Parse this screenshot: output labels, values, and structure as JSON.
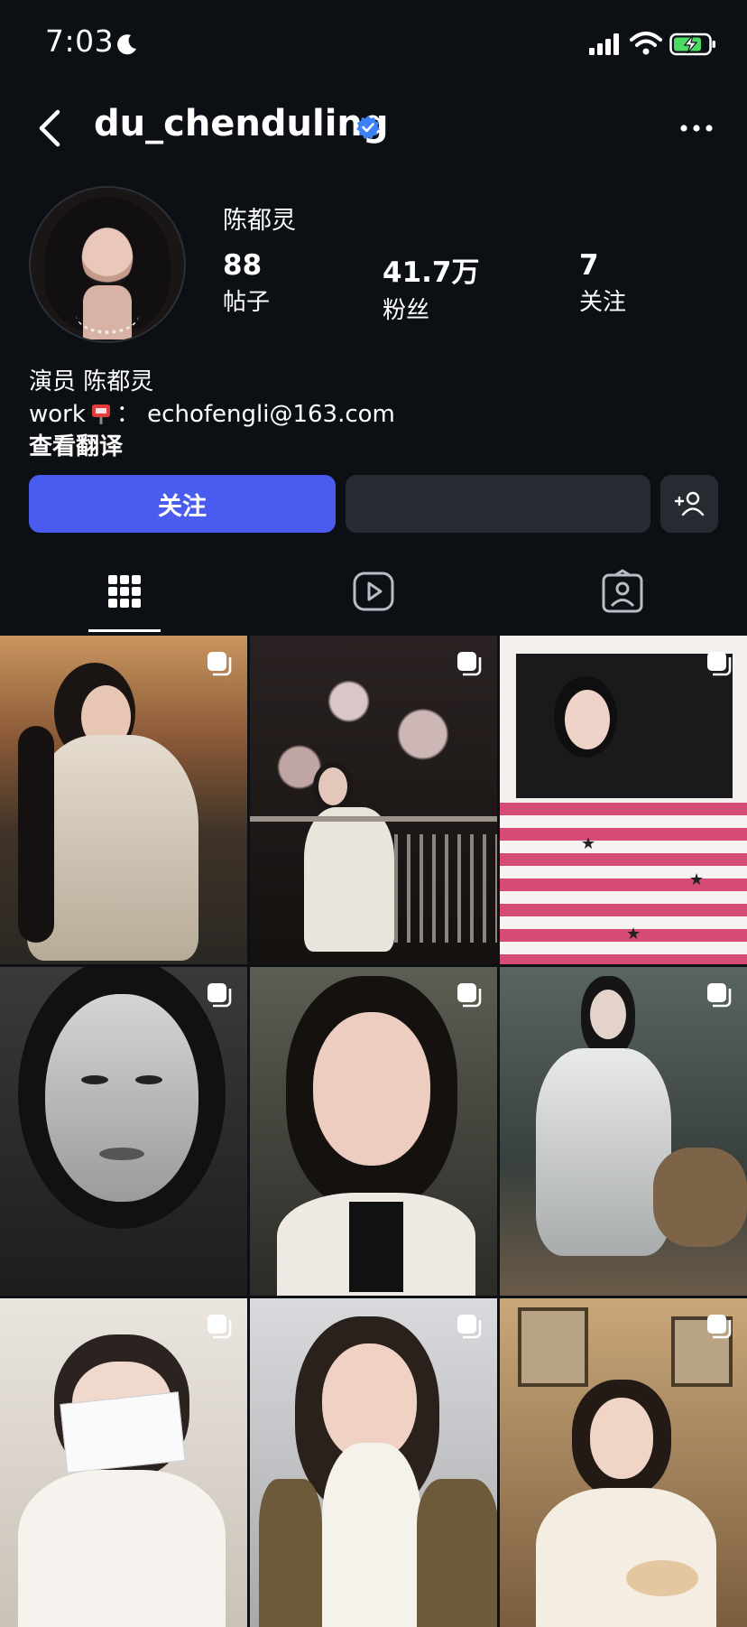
{
  "status_bar": {
    "time": "7:03"
  },
  "header": {
    "username": "du_chenduling"
  },
  "profile": {
    "display_name": "陈都灵",
    "stats": [
      {
        "value": "88",
        "label": "帖子"
      },
      {
        "value": "41.7万",
        "label": "粉丝"
      },
      {
        "value": "7",
        "label": "关注"
      }
    ],
    "bio_line1": "演员 陈都灵",
    "bio_work_prefix": "work",
    "bio_work_suffix": "：  echofengli@163.com",
    "see_translation": "查看翻译"
  },
  "actions": {
    "follow_label": "关注",
    "message_label": ""
  },
  "tabs": [
    "posts-grid",
    "reels",
    "tagged"
  ],
  "colors": {
    "background": "#0c0f14",
    "follow_button": "#4a5bf0",
    "verified": "#3d82f5",
    "secondary_button": "#262a31"
  },
  "posts": [
    {
      "desc": "long hair white dress sunset"
    },
    {
      "desc": "cherry blossom night railing"
    },
    {
      "desc": "pink stripes stars"
    },
    {
      "desc": "black and white portrait"
    },
    {
      "desc": "hand near chin portrait"
    },
    {
      "desc": "silver dress by water"
    },
    {
      "desc": "holding paper sign"
    },
    {
      "desc": "white scarf winter"
    },
    {
      "desc": "vintage room cake"
    }
  ]
}
